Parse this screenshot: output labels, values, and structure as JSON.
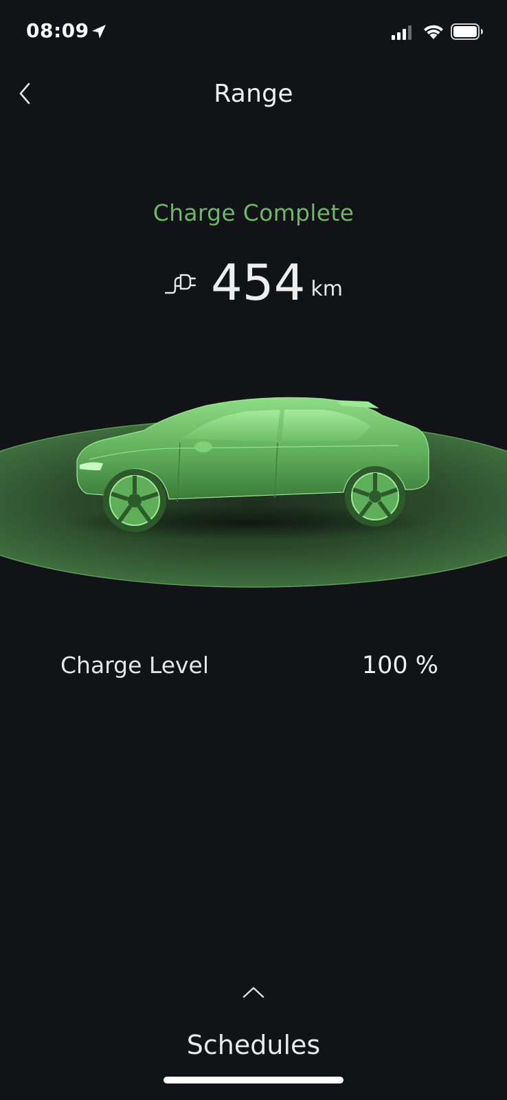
{
  "status_bar": {
    "time": "08:09",
    "location_icon": "location-arrow-icon",
    "signal_icon": "cellular-signal-icon",
    "wifi_icon": "wifi-icon",
    "battery_icon": "battery-icon"
  },
  "header": {
    "title": "Range",
    "back_icon": "chevron-left-icon"
  },
  "charge": {
    "status": "Charge Complete",
    "plug_icon": "plug-icon",
    "range_value": "454",
    "range_unit": "km",
    "level_label": "Charge Level",
    "level_value": "100 %"
  },
  "footer": {
    "chevron_icon": "chevron-up-icon",
    "schedules_label": "Schedules"
  },
  "colors": {
    "background": "#111317",
    "accent_green": "#6cb866",
    "text": "#f1f1f1"
  }
}
